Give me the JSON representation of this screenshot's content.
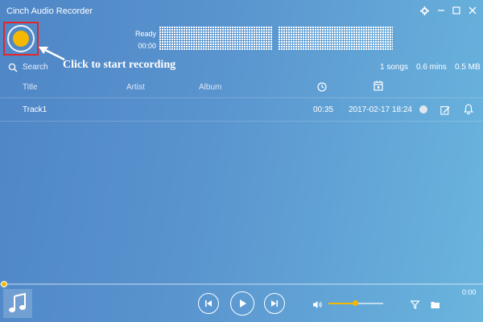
{
  "app": {
    "title": "Cinch Audio Recorder"
  },
  "recorder": {
    "status": "Ready",
    "time": "00:00",
    "hint": "Click to start recording"
  },
  "search": {
    "placeholder": "Search"
  },
  "stats": {
    "songs": "1 songs",
    "mins": "0.6 mins",
    "size": "0.5 MB"
  },
  "columns": {
    "title": "Title",
    "artist": "Artist",
    "album": "Album"
  },
  "tracks": [
    {
      "title": "Track1",
      "duration": "00:35",
      "date": "2017-02-17 18:24"
    }
  ],
  "player": {
    "elapsed": "0:00",
    "volume": 0.5,
    "progress": 0.0
  },
  "colors": {
    "accent": "#f5b700",
    "highlight": "#e3262a"
  }
}
